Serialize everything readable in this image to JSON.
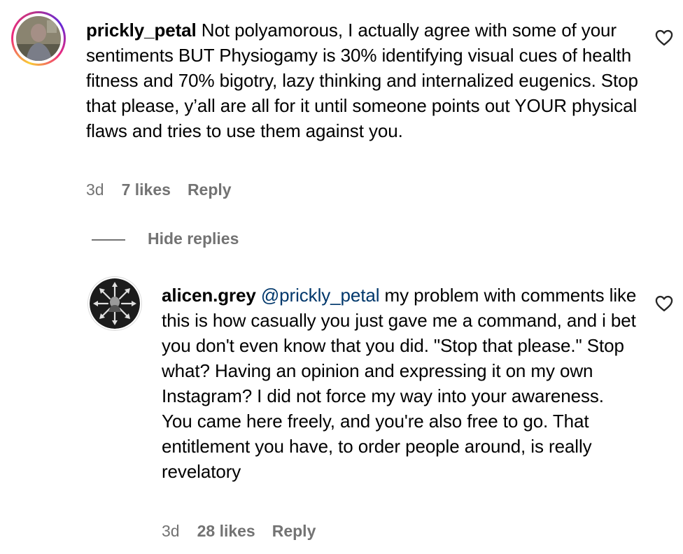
{
  "comments": [
    {
      "username": "prickly_petal",
      "text": "Not polyamorous, I actually agree with some of your sentiments BUT Physiogamy is 30% identifying visual cues of health fitness and 70% bigotry, lazy thinking and internalized eugenics. Stop that please, y’all are all for it until someone points out YOUR physical flaws and tries to use them against you.",
      "time": "3d",
      "likes": "7 likes",
      "reply_label": "Reply",
      "avatar_icon": "user-photo-avatar",
      "has_story_ring": true
    }
  ],
  "hide_replies_label": "Hide replies",
  "replies": [
    {
      "username": "alicen.grey",
      "mention": "@prickly_petal",
      "text": "my problem with comments like this is how casually you just gave me a command, and i bet you don't even know that you did. \"Stop that please.\" Stop what? Having an opinion and expressing it on my own Instagram? I did not force my way into your awareness. You came here freely, and you're also free to go. That entitlement you have, to order people around, is really revelatory",
      "time": "3d",
      "likes": "28 likes",
      "reply_label": "Reply",
      "avatar_icon": "arrows-compass-avatar"
    }
  ],
  "icons": {
    "like": "heart-outline-icon"
  },
  "colors": {
    "mention": "#00376b",
    "meta": "#737373",
    "story_ring": [
      "#f9ce34",
      "#ee2a7b",
      "#6228d7"
    ]
  }
}
